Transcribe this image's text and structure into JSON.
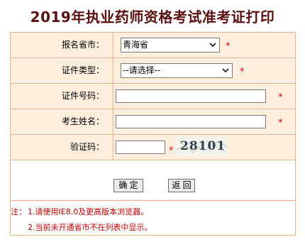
{
  "page": {
    "title": "2019年执业药师资格考试准考证打印"
  },
  "form": {
    "province": {
      "label": "报名省市：",
      "value": "青海省",
      "required_mark": "*"
    },
    "cert_type": {
      "label": "证件类型：",
      "value": "--请选择--",
      "required_mark": "*"
    },
    "cert_number": {
      "label": "证件号码：",
      "value": "",
      "required_mark": "*"
    },
    "name": {
      "label": "考生姓名：",
      "value": "",
      "required_mark": "*"
    },
    "captcha": {
      "label": "验证码：",
      "value": "",
      "required_mark": "*",
      "image_text": "28101"
    }
  },
  "buttons": {
    "confirm": "确 定",
    "back": "返 回"
  },
  "notes": {
    "prefix": "注：",
    "line1": "1.请使用IE8.0及更高版本浏览器。",
    "line2": "2.当前未开通省市不在列表中显示。"
  },
  "colors": {
    "title": "#5a1010",
    "border": "#e4b58a",
    "cell_bg": "#fdeede",
    "required": "#e00000",
    "note": "#c00000"
  }
}
